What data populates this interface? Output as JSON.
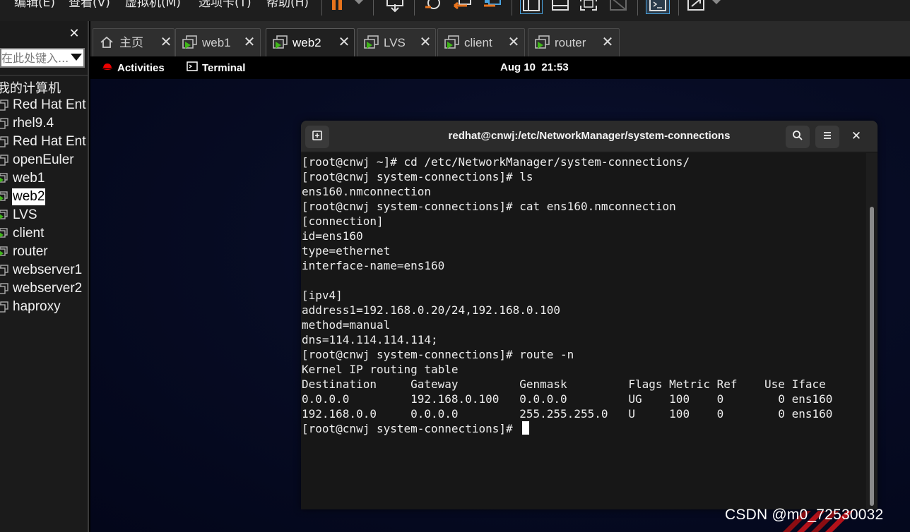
{
  "menubar": {
    "items": [
      "编辑(E)",
      "查看(V)",
      "虚拟机(M)",
      "选项卡(T)",
      "帮助(H)"
    ]
  },
  "toolbar": {
    "icons": [
      "pause-icon",
      "send-ctrl-alt-del-icon",
      "snapshot-icon",
      "revert-snapshot-icon",
      "snapshot-manager-icon",
      "sidebar-toggle-icon",
      "thumbnail-bar-icon",
      "fullscreen-icon",
      "unity-icon",
      "console-view-icon",
      "stretch-icon"
    ],
    "accent": "#e8731c"
  },
  "sidebar": {
    "search_placeholder": "在此处键入...",
    "root_label": "我的计算机",
    "items": [
      {
        "label": "Red Hat Ent",
        "icon": "vm-icon",
        "running": false
      },
      {
        "label": "rhel9.4",
        "icon": "vm-icon",
        "running": false
      },
      {
        "label": "Red Hat Ent",
        "icon": "vm-icon",
        "running": false
      },
      {
        "label": "openEuler",
        "icon": "vm-icon",
        "running": false
      },
      {
        "label": "web1",
        "icon": "vm-running-icon",
        "running": true
      },
      {
        "label": "web2",
        "icon": "vm-running-icon",
        "running": true,
        "selected": true
      },
      {
        "label": "LVS",
        "icon": "vm-running-icon",
        "running": true
      },
      {
        "label": "client",
        "icon": "vm-running-icon",
        "running": true
      },
      {
        "label": "router",
        "icon": "vm-running-icon",
        "running": true
      },
      {
        "label": "webserver1",
        "icon": "vm-icon",
        "running": false
      },
      {
        "label": "webserver2",
        "icon": "vm-icon",
        "running": false
      },
      {
        "label": "haproxy",
        "icon": "vm-icon",
        "running": false
      }
    ]
  },
  "tabs": [
    {
      "label": "主页",
      "icon": "home-icon",
      "active": false
    },
    {
      "label": "web1",
      "icon": "vm-running-icon",
      "active": false
    },
    {
      "label": "web2",
      "icon": "vm-running-icon",
      "active": true
    },
    {
      "label": "LVS",
      "icon": "vm-running-icon",
      "active": false
    },
    {
      "label": "client",
      "icon": "vm-running-icon",
      "active": false
    },
    {
      "label": "router",
      "icon": "vm-running-icon",
      "active": false
    }
  ],
  "gnome": {
    "activities": "Activities",
    "app": "Terminal",
    "clock": "Aug 10  21:53"
  },
  "terminal": {
    "title": "redhat@cnwj:/etc/NetworkManager/system-connections",
    "lines": [
      "[root@cnwj ~]# cd /etc/NetworkManager/system-connections/",
      "[root@cnwj system-connections]# ls",
      "ens160.nmconnection",
      "[root@cnwj system-connections]# cat ens160.nmconnection",
      "[connection]",
      "id=ens160",
      "type=ethernet",
      "interface-name=ens160",
      "",
      "[ipv4]",
      "address1=192.168.0.20/24,192.168.0.100",
      "method=manual",
      "dns=114.114.114.114;",
      "[root@cnwj system-connections]# route -n",
      "Kernel IP routing table",
      "Destination     Gateway         Genmask         Flags Metric Ref    Use Iface",
      "0.0.0.0         192.168.0.100   0.0.0.0         UG    100    0        0 ens160",
      "192.168.0.0     0.0.0.0         255.255.255.0   U     100    0        0 ens160",
      "[root@cnwj system-connections]# "
    ]
  },
  "watermark": "CSDN @m0_72530032"
}
